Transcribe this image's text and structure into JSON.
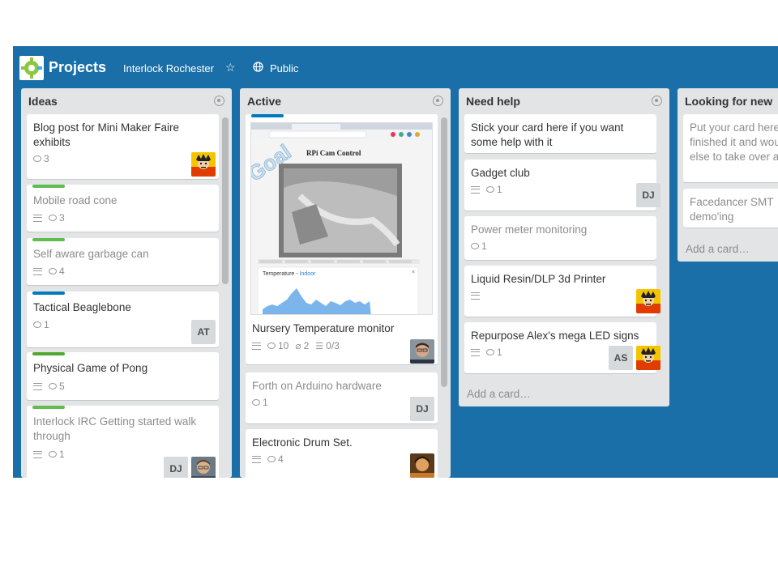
{
  "header": {
    "title": "Projects",
    "org": "Interlock Rochester",
    "visibility": "Public",
    "icons": [
      "logo-icon",
      "star-icon",
      "globe-icon"
    ]
  },
  "lists": [
    {
      "title": "Ideas",
      "cards": [
        {
          "title": "Blog post for Mini Maker Faire exhibits",
          "comments": "3"
        },
        {
          "title": "Mobile road cone",
          "comments": "3",
          "label_color": "#61bd4f"
        },
        {
          "title": "Self aware garbage can",
          "comments": "4",
          "label_color": "#61bd4f"
        },
        {
          "title": "Tactical Beaglebone",
          "comments": "1",
          "label_color": "#0079bf",
          "member": "AT"
        },
        {
          "title": "Physical Game of Pong",
          "comments": "5",
          "label_color": "#61bd4f"
        },
        {
          "title": "Interlock IRC Getting started walk through",
          "comments": "1",
          "label_color": "#61bd4f",
          "member": "DJ"
        }
      ]
    },
    {
      "title": "Active",
      "cards": [
        {
          "title": "Nursery Temperature monitor",
          "comments": "10",
          "attachments": "2",
          "checklist": "0/3",
          "label_color": "#0079bf",
          "cover": {
            "overlay_text": "Goal",
            "page_title": "RPi Cam Control",
            "chart_label": "Temperature - ",
            "chart_label_accent": "Indoor"
          }
        },
        {
          "title": "Forth on Arduino hardware",
          "comments": "1",
          "member": "DJ"
        },
        {
          "title": "Electronic Drum Set.",
          "comments": "4"
        }
      ]
    },
    {
      "title": "Need help",
      "cards": [
        {
          "title": "Stick your card here if you want some help with it"
        },
        {
          "title": "Gadget club",
          "comments": "1",
          "member": "DJ"
        },
        {
          "title": "Power meter monitoring",
          "comments": "1"
        },
        {
          "title": "Liquid Resin/DLP 3d Printer"
        },
        {
          "title": "Repurpose Alex's mega LED signs",
          "comments": "1",
          "member": "AS"
        }
      ],
      "add_card": "Add a card…"
    },
    {
      "title": "Looking for new",
      "cards": [
        {
          "title": "Put your card here when you've finished it and would like someone else to take over and help with it."
        },
        {
          "title": "Facedancer SMT demo'ing"
        }
      ],
      "add_card": "Add a card…"
    }
  ]
}
